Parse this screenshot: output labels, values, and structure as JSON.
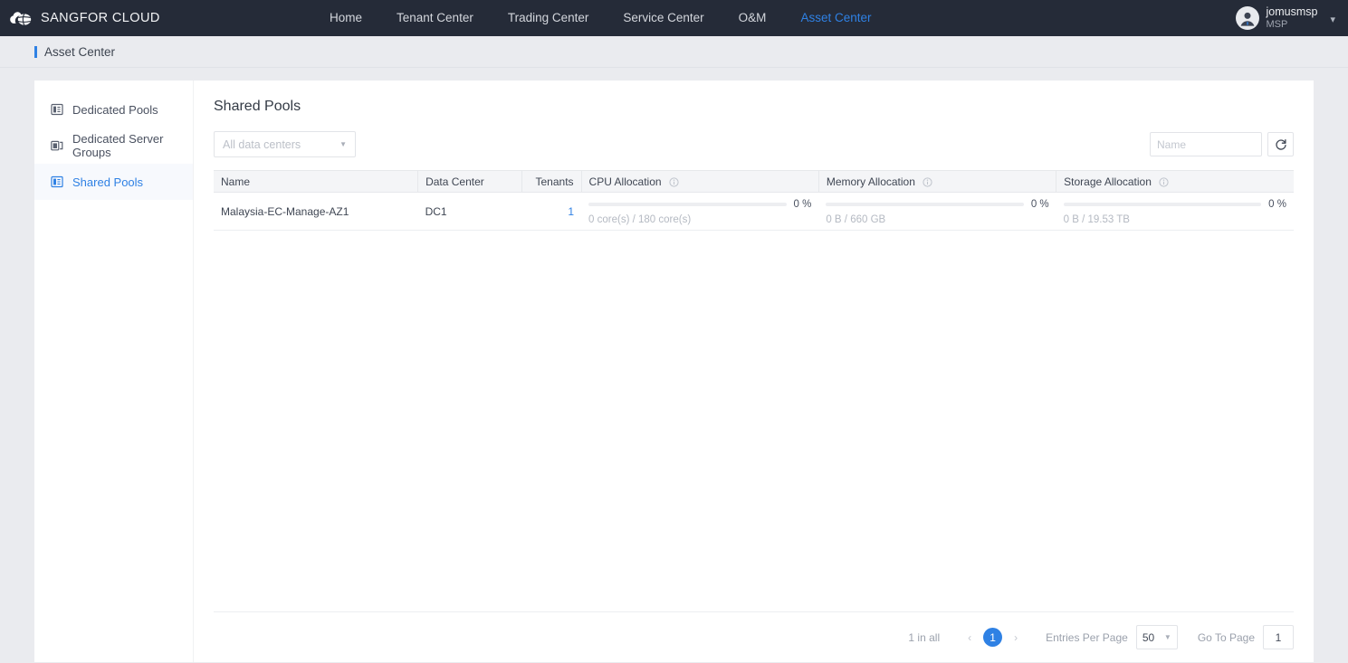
{
  "colors": {
    "topbar_bg": "#252b38",
    "accent": "#2f81e4",
    "page_bg": "#eaebef",
    "panel_bg": "#ffffff",
    "header_row_bg": "#f4f5f7"
  },
  "topbar": {
    "brand": "SANGFOR CLOUD",
    "logo_icon": "cloud-sphere-logo-icon",
    "nav": [
      {
        "label": "Home",
        "active": false
      },
      {
        "label": "Tenant Center",
        "active": false
      },
      {
        "label": "Trading Center",
        "active": false
      },
      {
        "label": "Service Center",
        "active": false
      },
      {
        "label": "O&M",
        "active": false
      },
      {
        "label": "Asset Center",
        "active": true
      }
    ],
    "user": {
      "name": "jomusmsp",
      "role": "MSP",
      "avatar_icon": "user-avatar-icon",
      "caret_icon": "chevron-down-icon"
    }
  },
  "breadcrumb": {
    "text": "Asset Center"
  },
  "sidebar": {
    "items": [
      {
        "label": "Dedicated Pools",
        "icon": "pool-list-icon",
        "active": false
      },
      {
        "label": "Dedicated Server Groups",
        "icon": "server-group-icon",
        "active": false
      },
      {
        "label": "Shared Pools",
        "icon": "pool-list-icon",
        "active": true
      }
    ]
  },
  "main": {
    "title": "Shared Pools",
    "filter": {
      "data_center_select": "All data centers",
      "select_arrow_icon": "caret-down-icon"
    },
    "search": {
      "placeholder": "Name",
      "value": "",
      "icon": "search-icon"
    },
    "refresh": {
      "icon": "refresh-icon",
      "label": ""
    },
    "table": {
      "columns": [
        {
          "label": "Name",
          "has_info": false,
          "align": "left"
        },
        {
          "label": "Data Center",
          "has_info": false,
          "align": "left"
        },
        {
          "label": "Tenants",
          "has_info": false,
          "align": "right"
        },
        {
          "label": "CPU Allocation",
          "has_info": true,
          "align": "left"
        },
        {
          "label": "Memory Allocation",
          "has_info": true,
          "align": "left"
        },
        {
          "label": "Storage Allocation",
          "has_info": true,
          "align": "left"
        }
      ],
      "info_icon": "info-circle-icon",
      "rows": [
        {
          "name": "Malaysia-EC-Manage-AZ1",
          "data_center": "DC1",
          "tenants": "1",
          "cpu": {
            "percent_label": "0 %",
            "percent": 0,
            "detail": "0 core(s) / 180 core(s)"
          },
          "memory": {
            "percent_label": "0 %",
            "percent": 0,
            "detail": "0 B / 660 GB"
          },
          "storage": {
            "percent_label": "0 %",
            "percent": 0,
            "detail": "0 B / 19.53 TB"
          }
        }
      ]
    },
    "pagination": {
      "total_text": "1 in all",
      "prev_icon": "chevron-left-icon",
      "next_icon": "chevron-right-icon",
      "current_page": "1",
      "entries_label": "Entries Per Page",
      "entries_value": "50",
      "entries_arrow_icon": "caret-down-icon",
      "goto_label": "Go To Page",
      "goto_value": "1"
    }
  }
}
